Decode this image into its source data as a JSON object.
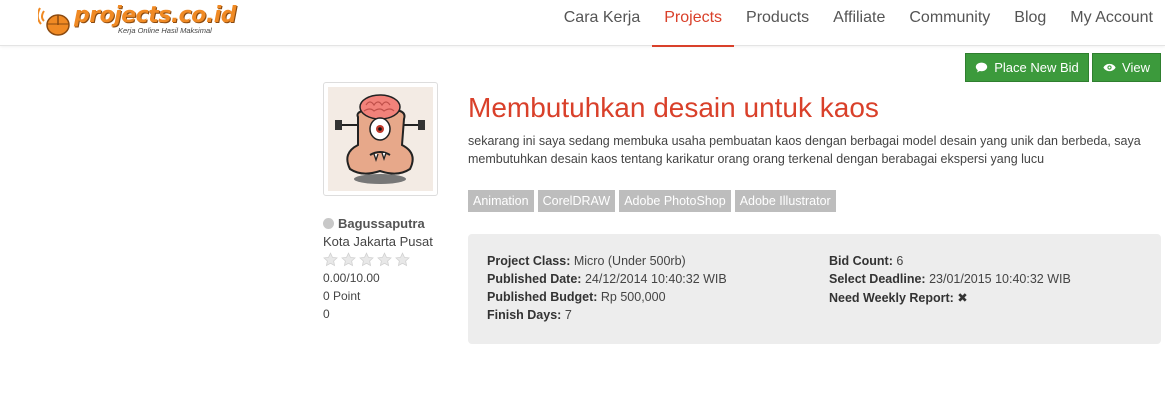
{
  "header": {
    "logo_text": "projects.co.id",
    "logo_tagline": "Kerja Online Hasil Maksimal",
    "nav": [
      {
        "label": "Cara Kerja"
      },
      {
        "label": "Projects"
      },
      {
        "label": "Products"
      },
      {
        "label": "Affiliate"
      },
      {
        "label": "Community"
      },
      {
        "label": "Blog"
      },
      {
        "label": "My Account"
      }
    ],
    "active_nav": "Projects"
  },
  "actions": {
    "place_bid_label": "Place New Bid",
    "view_label": "View"
  },
  "owner": {
    "name": "Bagussaputra",
    "city": "Kota Jakarta Pusat",
    "stars_filled": 0,
    "stars_total": 5,
    "rating": "0.00/10.00",
    "points": "0 Point",
    "extra": "0"
  },
  "project": {
    "title": "Membutuhkan desain untuk kaos",
    "description": "sekarang ini saya sedang membuka usaha pembuatan kaos dengan berbagai model desain yang unik dan berbeda, saya membutuhkan desain kaos tentang karikatur orang orang terkenal dengan berabagai ekspersi yang lucu",
    "tags": [
      "Animation",
      "CorelDRAW",
      "Adobe PhotoShop",
      "Adobe Illustrator"
    ],
    "details": {
      "project_class_label": "Project Class:",
      "project_class": "Micro (Under 500rb)",
      "published_date_label": "Published Date:",
      "published_date": "24/12/2014 10:40:32 WIB",
      "published_budget_label": "Published Budget:",
      "published_budget": "Rp 500,000",
      "finish_days_label": "Finish Days:",
      "finish_days": "7",
      "bid_count_label": "Bid Count:",
      "bid_count": "6",
      "select_deadline_label": "Select Deadline:",
      "select_deadline": "23/01/2015 10:40:32 WIB",
      "weekly_report_label": "Need Weekly Report:",
      "weekly_report": "✖"
    }
  },
  "colors": {
    "accent": "#d9402a",
    "button_green": "#3c9a3c",
    "tag_gray": "#bdbdbd",
    "panel_bg": "#ededed",
    "logo_orange": "#f08a24"
  }
}
